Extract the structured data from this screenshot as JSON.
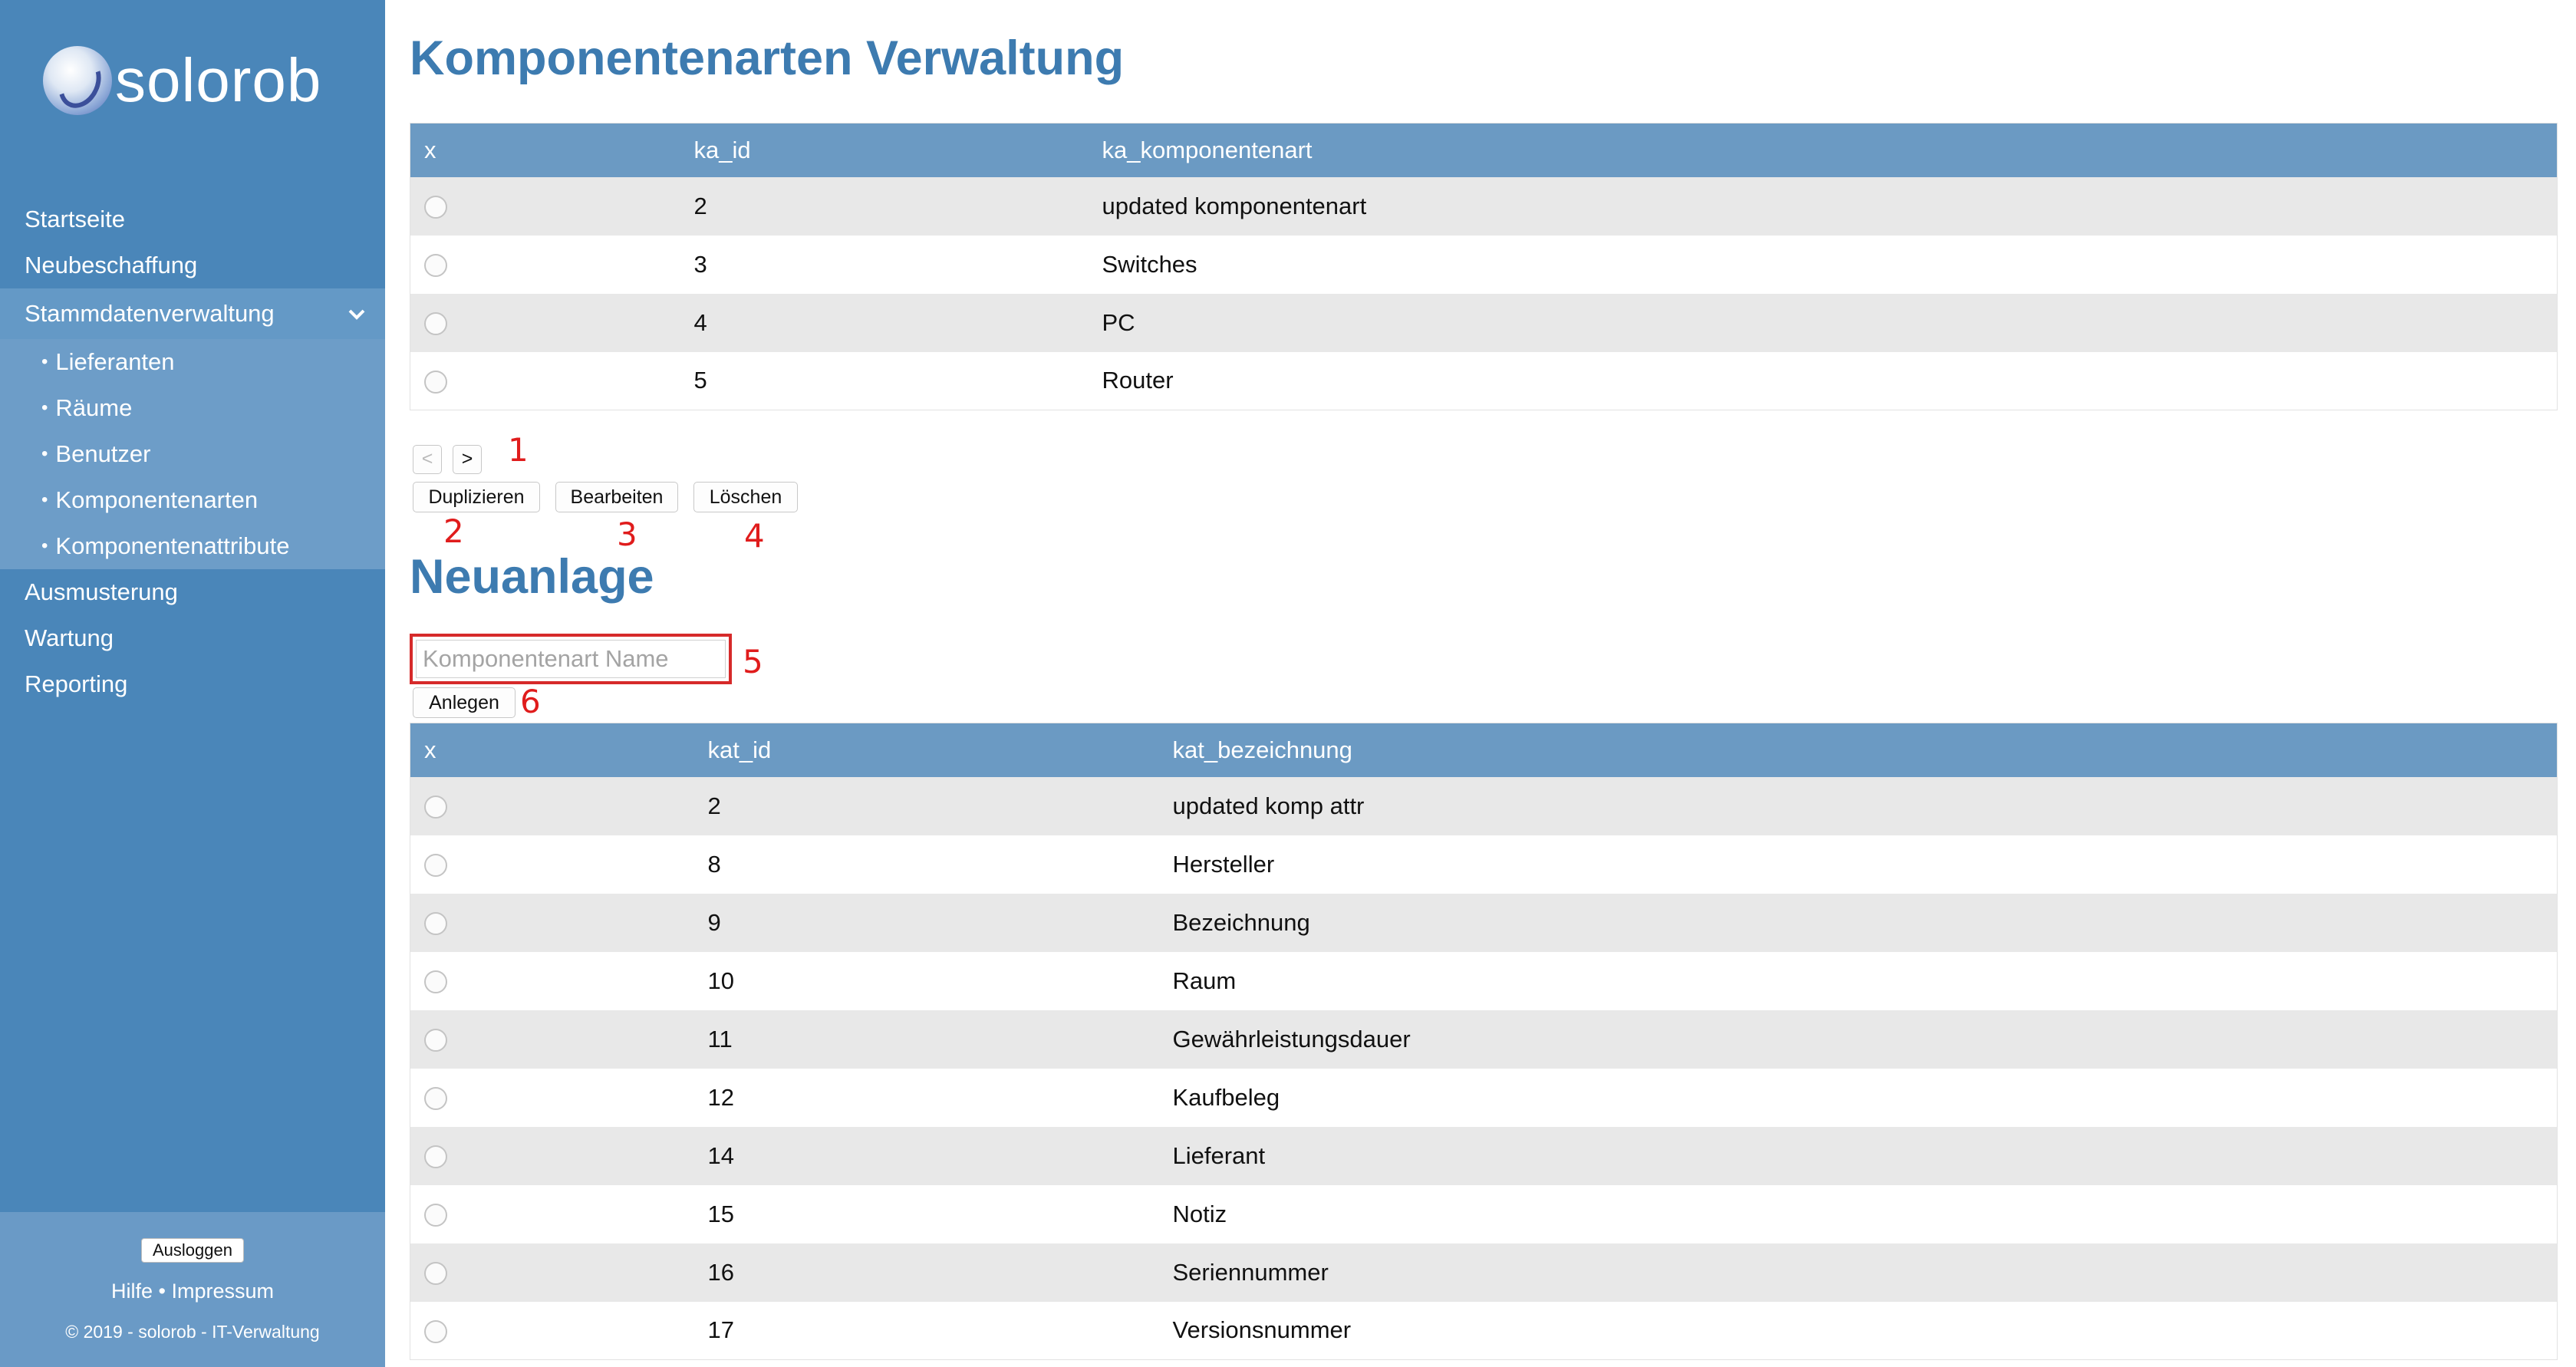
{
  "sidebar": {
    "logo_text": "solorob",
    "nav": [
      {
        "label": "Startseite"
      },
      {
        "label": "Neubeschaffung"
      },
      {
        "label": "Stammdatenverwaltung",
        "expanded": true
      },
      {
        "label": "Ausmusterung"
      },
      {
        "label": "Wartung"
      },
      {
        "label": "Reporting"
      }
    ],
    "subnav": [
      {
        "label": "Lieferanten"
      },
      {
        "label": "Räume"
      },
      {
        "label": "Benutzer"
      },
      {
        "label": "Komponentenarten"
      },
      {
        "label": "Komponentenattribute"
      }
    ],
    "logout_label": "Ausloggen",
    "help_label": "Hilfe",
    "separator": "•",
    "imprint_label": "Impressum",
    "copyright": "© 2019 - solorob - IT-Verwaltung"
  },
  "main": {
    "title": "Komponentenarten Verwaltung",
    "table1": {
      "headers": [
        "x",
        "ka_id",
        "ka_komponentenart"
      ],
      "rows": [
        {
          "id": "2",
          "name": "updated komponentenart"
        },
        {
          "id": "3",
          "name": "Switches"
        },
        {
          "id": "4",
          "name": "PC"
        },
        {
          "id": "5",
          "name": "Router"
        }
      ]
    },
    "pager": {
      "prev": "<",
      "next": ">"
    },
    "buttons": {
      "duplicate": "Duplizieren",
      "edit": "Bearbeiten",
      "delete": "Löschen"
    },
    "new_section_title": "Neuanlage",
    "input_placeholder": "Komponentenart Name",
    "create_label": "Anlegen",
    "table2": {
      "headers": [
        "x",
        "kat_id",
        "kat_bezeichnung"
      ],
      "rows": [
        {
          "id": "2",
          "name": "updated komp attr"
        },
        {
          "id": "8",
          "name": "Hersteller"
        },
        {
          "id": "9",
          "name": "Bezeichnung"
        },
        {
          "id": "10",
          "name": "Raum"
        },
        {
          "id": "11",
          "name": "Gewährleistungsdauer"
        },
        {
          "id": "12",
          "name": "Kaufbeleg"
        },
        {
          "id": "14",
          "name": "Lieferant"
        },
        {
          "id": "15",
          "name": "Notiz"
        },
        {
          "id": "16",
          "name": "Seriennummer"
        },
        {
          "id": "17",
          "name": "Versionsnummer"
        }
      ]
    }
  },
  "annotations": [
    "1",
    "2",
    "3",
    "4",
    "5",
    "6"
  ],
  "colors": {
    "sidebar": "#4a86b9",
    "title": "#3d7bb0",
    "table_header": "#6b9ac3",
    "annotation": "#e01c1c"
  }
}
